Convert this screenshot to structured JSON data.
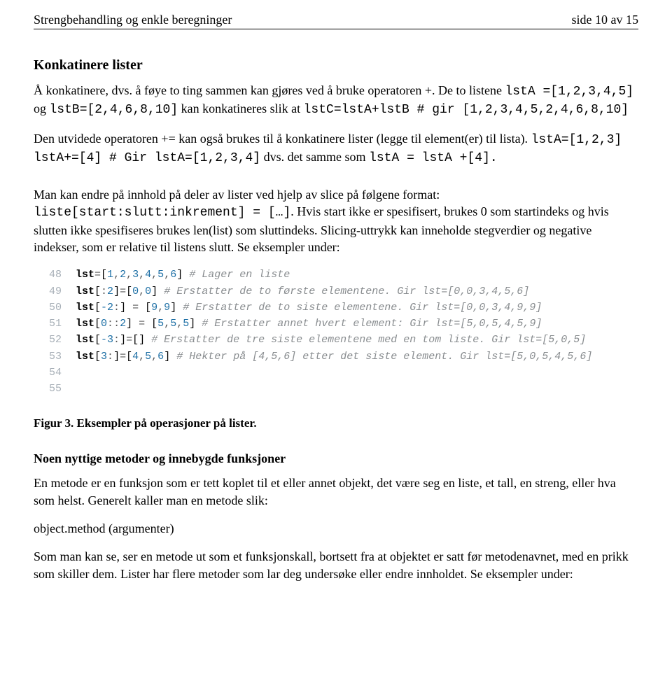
{
  "header": {
    "left": "Strengbehandling og enkle beregninger",
    "right": "side 10 av 15"
  },
  "section1_heading": "Konkatinere lister",
  "para1_part1": "Å konkatinere, dvs. å føye to ting sammen kan gjøres ved å bruke operatoren +. De to listene ",
  "para1_code1": "lstA =[1,2,3,4,5]",
  "para1_part2": " og ",
  "para1_code2": "lstB=[2,4,6,8,10]",
  "para1_part3": " kan konkatineres slik at ",
  "para1_code3": "lstC=lstA+lstB  # gir [1,2,3,4,5,2,4,6,8,10]",
  "para2_part1": "Den utvidede operatoren += kan også brukes til å konkatinere lister (legge til element(er) til lista). ",
  "para2_code1": "lstA=[1,2,3]   lstA+=[4] # Gir lstA=[1,2,3,4]",
  "para2_part2": " dvs. det samme som ",
  "para2_code2": "lstA = lstA +[4].",
  "para3_part1": "Man kan endre på innhold på deler av lister ved hjelp av slice på følgene format: ",
  "para3_code1": "liste[start:slutt:inkrement] = […]",
  "para3_part2": ". Hvis start ikke er spesifisert, brukes 0 som startindeks og hvis slutten ikke spesifiseres brukes len(list) som sluttindeks. Slicing-uttrykk kan inneholde stegverdier og negative indekser, som er relative til listens slutt. Se eksempler under:",
  "code_lines": [
    {
      "n": "48",
      "var": "lst",
      "assign": "=[",
      "vals": "1,2,3,4,5,6",
      "close": "] ",
      "cmt": "# Lager en liste"
    },
    {
      "n": "49",
      "var": "lst",
      "slice": "[:2]",
      "assign": "=[",
      "vals": "0,0",
      "close": "] ",
      "cmt": "# Erstatter de to første elementene. Gir lst=[0,0,3,4,5,6]"
    },
    {
      "n": "50",
      "var": "lst",
      "slice": "[-2:]",
      "assign": " = [",
      "vals": "9,9",
      "close": "] ",
      "cmt": "# Erstatter de to siste elementene. Gir lst=[0,0,3,4,9,9]"
    },
    {
      "n": "51",
      "var": "lst",
      "slice": "[0::2]",
      "assign": " = [",
      "vals": "5,5,5",
      "close": "] ",
      "cmt": "# Erstatter annet hvert element: Gir lst=[5,0,5,4,5,9]"
    },
    {
      "n": "52",
      "var": "lst",
      "slice": "[-3:]",
      "assign": "=[",
      "vals": "",
      "close": "] ",
      "cmt": "# Erstatter de tre siste elementene med en tom liste. Gir lst=[5,0,5]"
    },
    {
      "n": "53",
      "var": "lst",
      "slice": "[3:]",
      "assign": "=[",
      "vals": "4,5,6",
      "close": "] ",
      "cmt": "# Hekter på [4,5,6] etter det siste element. Gir lst=[5,0,5,4,5,6]"
    },
    {
      "n": "54",
      "var": "",
      "slice": "",
      "assign": "",
      "vals": "",
      "close": "",
      "cmt": ""
    },
    {
      "n": "55",
      "var": "",
      "slice": "",
      "assign": "",
      "vals": "",
      "close": "",
      "cmt": ""
    }
  ],
  "figure_caption": "Figur 3. Eksempler på operasjoner på lister.",
  "section2_heading": "Noen nyttige metoder og innebygde funksjoner",
  "para4": "En metode er en funksjon som er tett koplet til et eller annet objekt, det være seg en liste, et tall, en streng, eller hva som helst. Generelt kaller man en metode slik:",
  "para5": "object.method (argumenter)",
  "para6": "Som man kan se, ser en metode ut som et funksjonskall, bortsett fra at objektet er satt før metodenavnet, med en prikk som skiller dem. Lister har flere metoder som lar deg undersøke eller endre innholdet. Se eksempler under:"
}
